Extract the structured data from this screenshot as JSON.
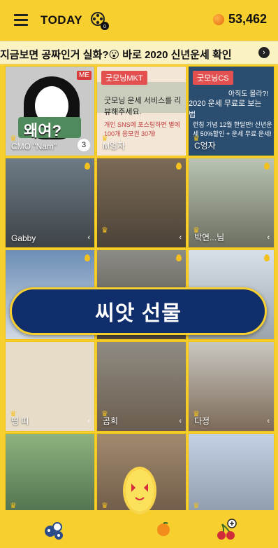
{
  "header": {
    "title": "TODAY",
    "film_icon": "film-reel-icon",
    "coin_icon": "tangerine-coin-icon",
    "coin_count": "53,462"
  },
  "banner": {
    "text": "지금보면 공짜인거 실화?😮 바로 2020 신년운세 확인",
    "arrow_icon": "arrow-right-circle-icon"
  },
  "tiles": [
    {
      "label": "CMO \"Nam\"",
      "title_text": "왜여?",
      "badge": "ME",
      "count": "3"
    },
    {
      "label": "M엉자",
      "tag": "굿모닝MKT",
      "message": "굿모닝 운세 서비스를 리뷰해주세요.",
      "sub": "개인 SNS에 포스팅하면 별에 100개 응모권 30개!"
    },
    {
      "label": "C엉자",
      "tag": "굿모닝CS",
      "hint": "아직도 몰라?!",
      "message": "2020 운세 무료로 보는 법",
      "sub": "런칭 기념 12월 한달만! 신년운세 50%할인 + 운세 무료 운세!"
    },
    {
      "label": "Gabby"
    },
    {
      "label": ""
    },
    {
      "label": "박연...님"
    },
    {
      "label": ""
    },
    {
      "label": ""
    },
    {
      "label": ""
    },
    {
      "label": "띵 띠"
    },
    {
      "label": "곰희"
    },
    {
      "label": "다정"
    },
    {
      "label": ""
    },
    {
      "label": ""
    },
    {
      "label": ""
    }
  ],
  "gift": {
    "text": "씨앗 선물"
  },
  "bottom_nav": {
    "left_icon": "seeds-icon",
    "center_icon": "lemon-mascot-icon",
    "right_icon": "cherry-plus-icon"
  }
}
